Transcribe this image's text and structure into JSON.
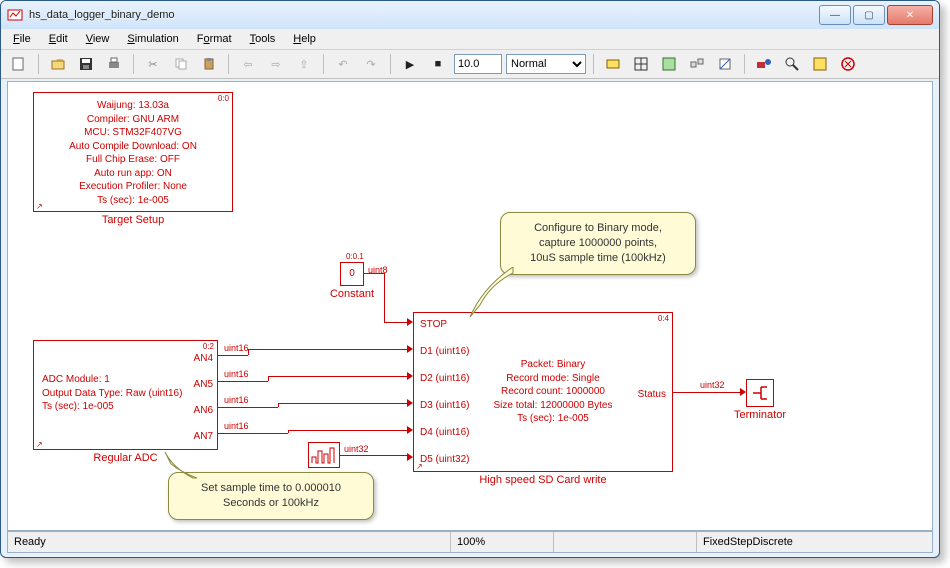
{
  "window": {
    "title": "hs_data_logger_binary_demo"
  },
  "menu": {
    "file": "File",
    "edit": "Edit",
    "view": "View",
    "simulation": "Simulation",
    "format": "Format",
    "tools": "Tools",
    "help": "Help"
  },
  "toolbar": {
    "stop_time": "10.0",
    "mode": "Normal"
  },
  "status": {
    "ready": "Ready",
    "zoom": "100%",
    "solver": "FixedStepDiscrete"
  },
  "target_setup": {
    "lines": [
      "Waijung: 13.03a",
      "Compiler: GNU ARM",
      "MCU: STM32F407VG",
      "Auto Compile Download: ON",
      "Full Chip Erase: OFF",
      "Auto run app: ON",
      "Execution Profiler: None",
      "Ts (sec): 1e-005"
    ],
    "label": "Target Setup",
    "tag": "0:0"
  },
  "constant": {
    "value": "0",
    "label": "Constant",
    "tag": "0:0.1",
    "dtype": "uint8"
  },
  "adc": {
    "lines": [
      "ADC Module: 1",
      "Output Data Type: Raw (uint16)",
      "Ts (sec): 1e-005"
    ],
    "label": "Regular ADC",
    "tag": "0:2",
    "ports": [
      "AN4",
      "AN5",
      "AN6",
      "AN7"
    ],
    "dtype": "uint16"
  },
  "counter": {
    "dtype": "uint32"
  },
  "sd": {
    "in_ports": [
      "STOP",
      "D1 (uint16)",
      "D2 (uint16)",
      "D3 (uint16)",
      "D4 (uint16)",
      "D5 (uint32)"
    ],
    "lines": [
      "Packet: Binary",
      "Record mode: Single",
      "Record count: 1000000",
      "Size total: 12000000 Bytes",
      "Ts (sec): 1e-005"
    ],
    "out_port": "Status",
    "out_dtype": "uint32",
    "tag": "0:4",
    "label": "High speed SD Card write"
  },
  "terminator": {
    "label": "Terminator"
  },
  "callouts": {
    "top": {
      "l1": "Configure to Binary mode,",
      "l2": "capture 1000000 points,",
      "l3": "10uS sample time (100kHz)"
    },
    "bottom": {
      "l1": "Set sample time to 0.000010",
      "l2": "Seconds or 100kHz"
    }
  }
}
